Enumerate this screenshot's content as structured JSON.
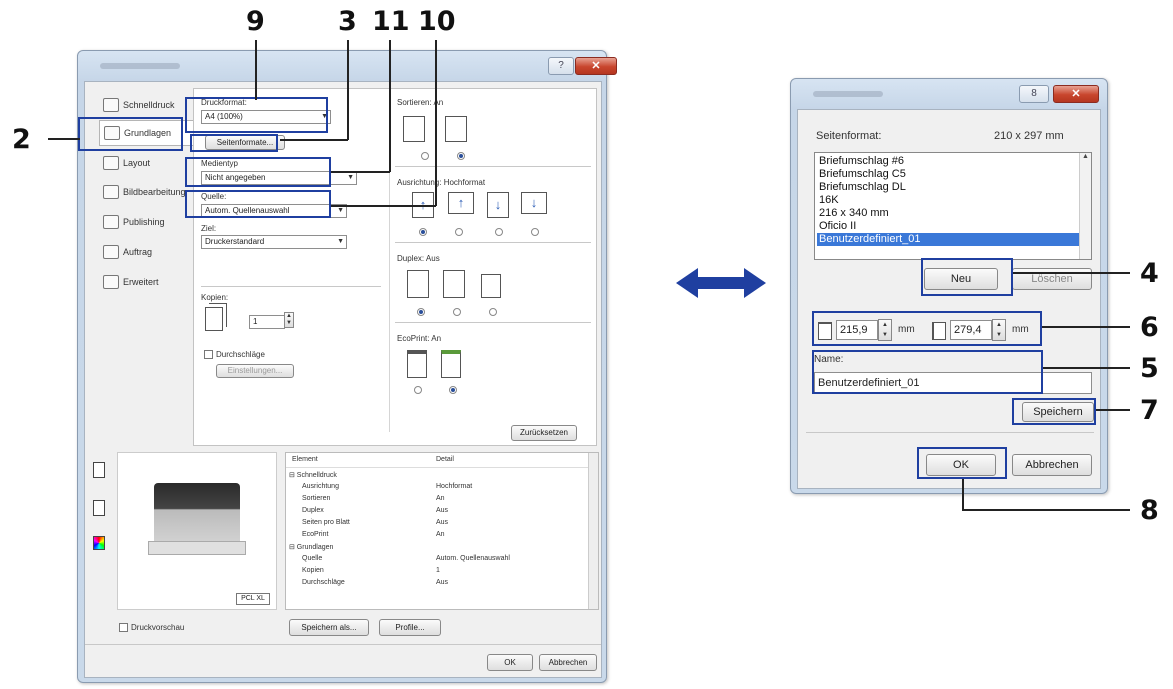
{
  "callouts": {
    "n9": "9",
    "n3": "3",
    "n11": "11",
    "n10": "10",
    "n2": "2",
    "n4": "4",
    "n6": "6",
    "n5": "5",
    "n7": "7",
    "n8": "8"
  },
  "main": {
    "sidebar": [
      {
        "label": "Schnelldruck"
      },
      {
        "label": "Grundlagen"
      },
      {
        "label": "Layout"
      },
      {
        "label": "Bildbearbeitung"
      },
      {
        "label": "Publishing"
      },
      {
        "label": "Auftrag"
      },
      {
        "label": "Erweitert"
      }
    ],
    "druckformat_label": "Druckformat:",
    "druckformat_value": "A4 (100%)",
    "seitenformate_button": "Seitenformate...",
    "medientyp_label": "Medientyp",
    "medientyp_value": "Nicht angegeben",
    "quelle_label": "Quelle:",
    "quelle_value": "Autom. Quellenauswahl",
    "ziel_label": "Ziel:",
    "ziel_value": "Druckerstandard",
    "kopien_label": "Kopien:",
    "kopien_value": "1",
    "durchschlaege_label": "Durchschläge",
    "einstellungen_button": "Einstellungen...",
    "sortieren_label": "Sortieren: An",
    "ausrichtung_label": "Ausrichtung: Hochformat",
    "duplex_label": "Duplex: Aus",
    "ecoprint_label": "EcoPrint: An",
    "zuruecksetzen_button": "Zurücksetzen",
    "table": {
      "head_element": "Element",
      "head_detail": "Detail",
      "rows": [
        {
          "element": "⊟ Schnelldruck",
          "detail": ""
        },
        {
          "element": "Ausrichtung",
          "detail": "Hochformat"
        },
        {
          "element": "Sortieren",
          "detail": "An"
        },
        {
          "element": "Duplex",
          "detail": "Aus"
        },
        {
          "element": "Seiten pro Blatt",
          "detail": "Aus"
        },
        {
          "element": "EcoPrint",
          "detail": "An"
        },
        {
          "element": "⊟ Grundlagen",
          "detail": ""
        },
        {
          "element": "Quelle",
          "detail": "Autom. Quellenauswahl"
        },
        {
          "element": "Kopien",
          "detail": "1"
        },
        {
          "element": "Durchschläge",
          "detail": "Aus"
        }
      ]
    },
    "pcl_badge": "PCL XL",
    "druckvorschau_label": "Druckvorschau",
    "speichern_als_button": "Speichern als...",
    "profile_button": "Profile...",
    "ok_button": "OK",
    "abbrechen_button": "Abbrechen"
  },
  "right": {
    "seitenformat_label": "Seitenformat:",
    "seitenformat_size": "210 x 297 mm",
    "list": [
      "Briefumschlag #6",
      "Briefumschlag C5",
      "Briefumschlag DL",
      "16K",
      "216 x 340 mm",
      "Oficio II",
      "Benutzerdefiniert_01"
    ],
    "selected_index": 6,
    "neu_button": "Neu",
    "loeschen_button": "Löschen",
    "width_value": "215,9",
    "height_value": "279,4",
    "unit_mm": "mm",
    "name_label": "Name:",
    "name_value": "Benutzerdefiniert_01",
    "speichern_button": "Speichern",
    "ok_button": "OK",
    "abbrechen_button": "Abbrechen"
  },
  "colors": {
    "callout_box": "#1f3fa0",
    "selection": "#3a78d8",
    "arrow": "#1f3fa0"
  }
}
